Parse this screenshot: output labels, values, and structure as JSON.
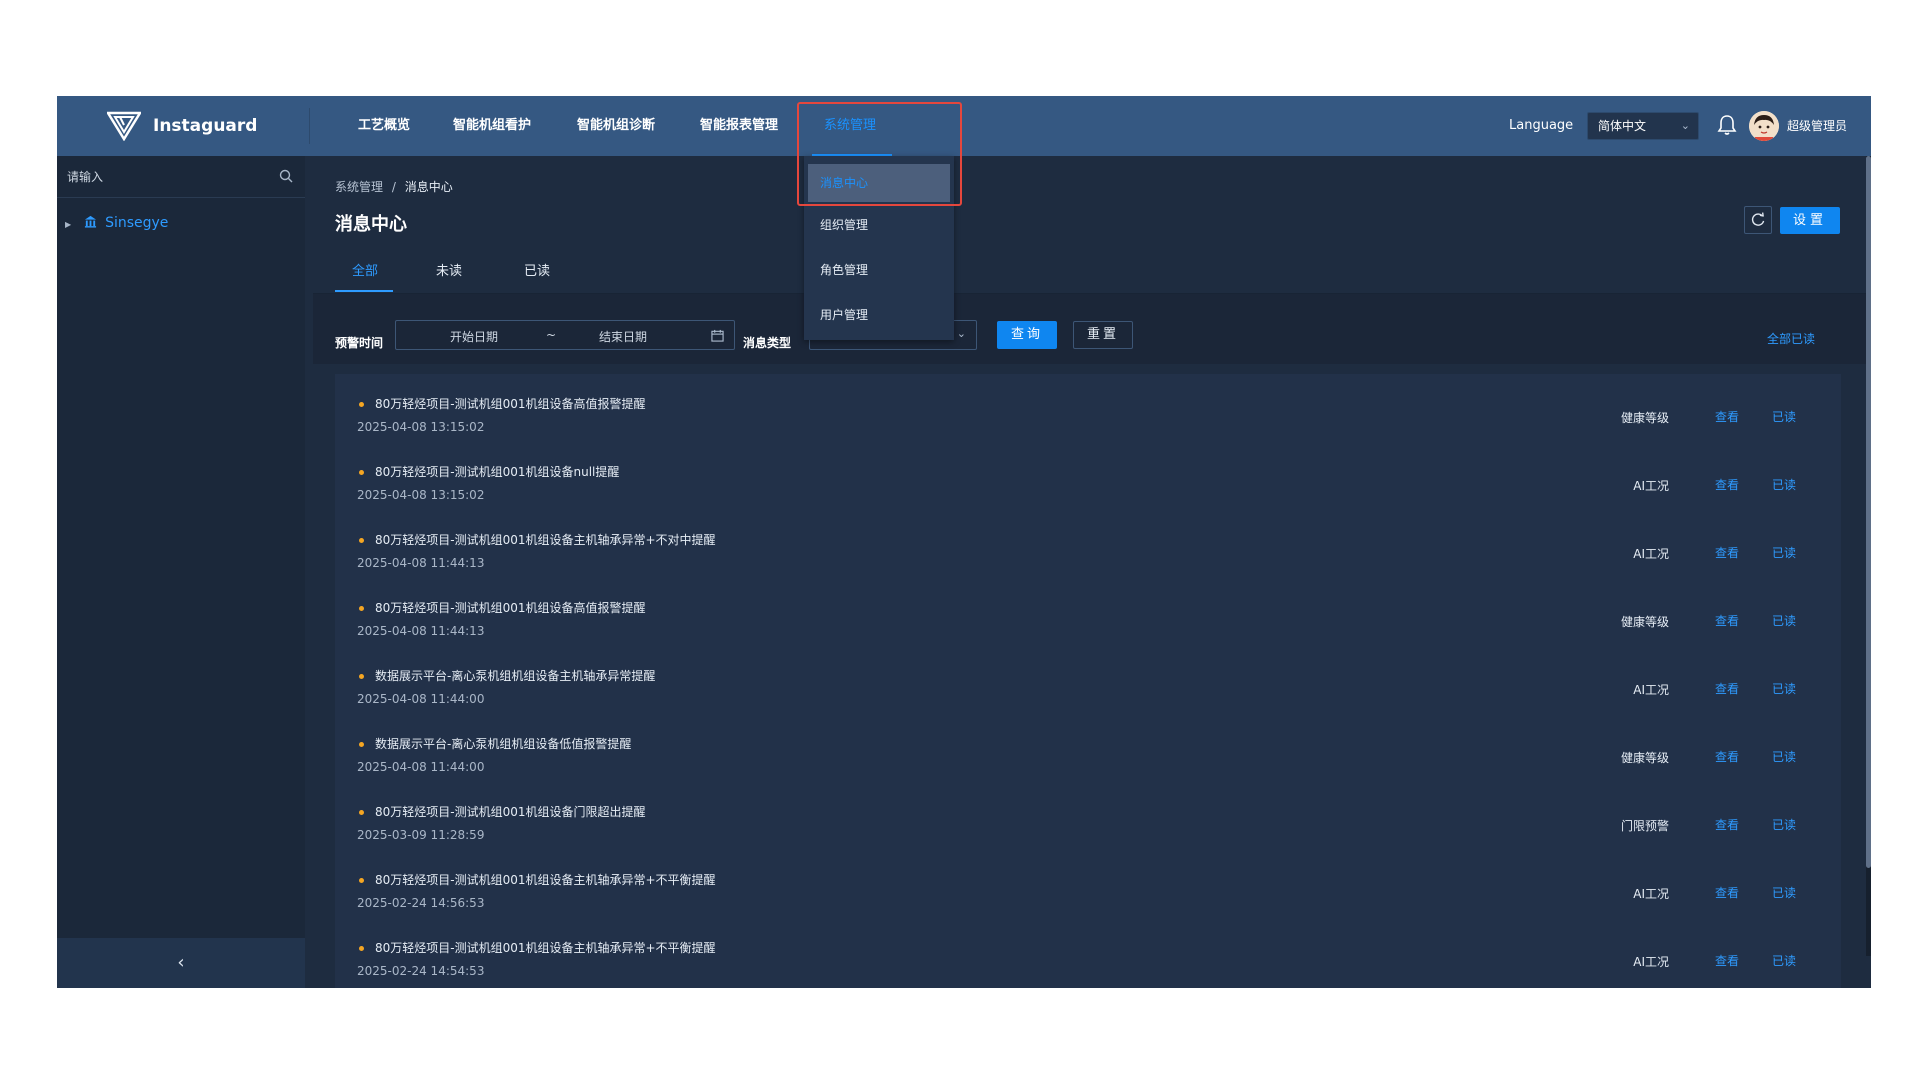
{
  "brand": {
    "name": "Instaguard"
  },
  "nav": {
    "items": [
      {
        "label": "工艺概览"
      },
      {
        "label": "智能机组看护"
      },
      {
        "label": "智能机组诊断"
      },
      {
        "label": "智能报表管理"
      },
      {
        "label": "系统管理",
        "active": true
      }
    ],
    "dropdown": [
      {
        "label": "消息中心",
        "selected": true
      },
      {
        "label": "组织管理"
      },
      {
        "label": "角色管理"
      },
      {
        "label": "用户管理"
      }
    ]
  },
  "header": {
    "language_label": "Language",
    "language_value": "简体中文",
    "username": "超级管理员"
  },
  "sidebar": {
    "search_placeholder": "请输入",
    "tree": [
      {
        "label": "Sinsegye"
      }
    ],
    "collapse_glyph": "‹"
  },
  "main": {
    "breadcrumb": {
      "parent": "系统管理",
      "separator": "/",
      "current": "消息中心"
    },
    "title": "消息中心",
    "settings_label": "设置",
    "tabs": [
      {
        "label": "全部",
        "active": true
      },
      {
        "label": "未读"
      },
      {
        "label": "已读"
      }
    ],
    "filters": {
      "time_label": "预警时间",
      "start_placeholder": "开始日期",
      "range_sep": "~",
      "end_placeholder": "结束日期",
      "type_label": "消息类型",
      "query_label": "查询",
      "reset_label": "重置",
      "read_all_label": "全部已读"
    },
    "messages": [
      {
        "title": "80万轻烃项目-测试机组001机组设备高值报警提醒",
        "time": "2025-04-08 13:15:02",
        "type": "健康等级"
      },
      {
        "title": "80万轻烃项目-测试机组001机组设备null提醒",
        "time": "2025-04-08 13:15:02",
        "type": "AI工况"
      },
      {
        "title": "80万轻烃项目-测试机组001机组设备主机轴承异常+不对中提醒",
        "time": "2025-04-08 11:44:13",
        "type": "AI工况"
      },
      {
        "title": "80万轻烃项目-测试机组001机组设备高值报警提醒",
        "time": "2025-04-08 11:44:13",
        "type": "健康等级"
      },
      {
        "title": "数据展示平台-离心泵机组机组设备主机轴承异常提醒",
        "time": "2025-04-08 11:44:00",
        "type": "AI工况"
      },
      {
        "title": "数据展示平台-离心泵机组机组设备低值报警提醒",
        "time": "2025-04-08 11:44:00",
        "type": "健康等级"
      },
      {
        "title": "80万轻烃项目-测试机组001机组设备门限超出提醒",
        "time": "2025-03-09 11:28:59",
        "type": "门限预警"
      },
      {
        "title": "80万轻烃项目-测试机组001机组设备主机轴承异常+不平衡提醒",
        "time": "2025-02-24 14:56:53",
        "type": "AI工况"
      },
      {
        "title": "80万轻烃项目-测试机组001机组设备主机轴承异常+不平衡提醒",
        "time": "2025-02-24 14:54:53",
        "type": "AI工况"
      }
    ],
    "row_actions": {
      "view": "查看",
      "mark_read": "已读"
    }
  },
  "colors": {
    "accent": "#1a92ff",
    "topbar": "#355882",
    "highlight": "#e5473d",
    "unread_dot": "#f5a623"
  },
  "icons": [
    "logo-icon",
    "search-icon",
    "building-icon",
    "bell-icon",
    "avatar",
    "refresh-icon",
    "calendar-icon",
    "chevron-down-icon",
    "chevron-left-icon"
  ]
}
